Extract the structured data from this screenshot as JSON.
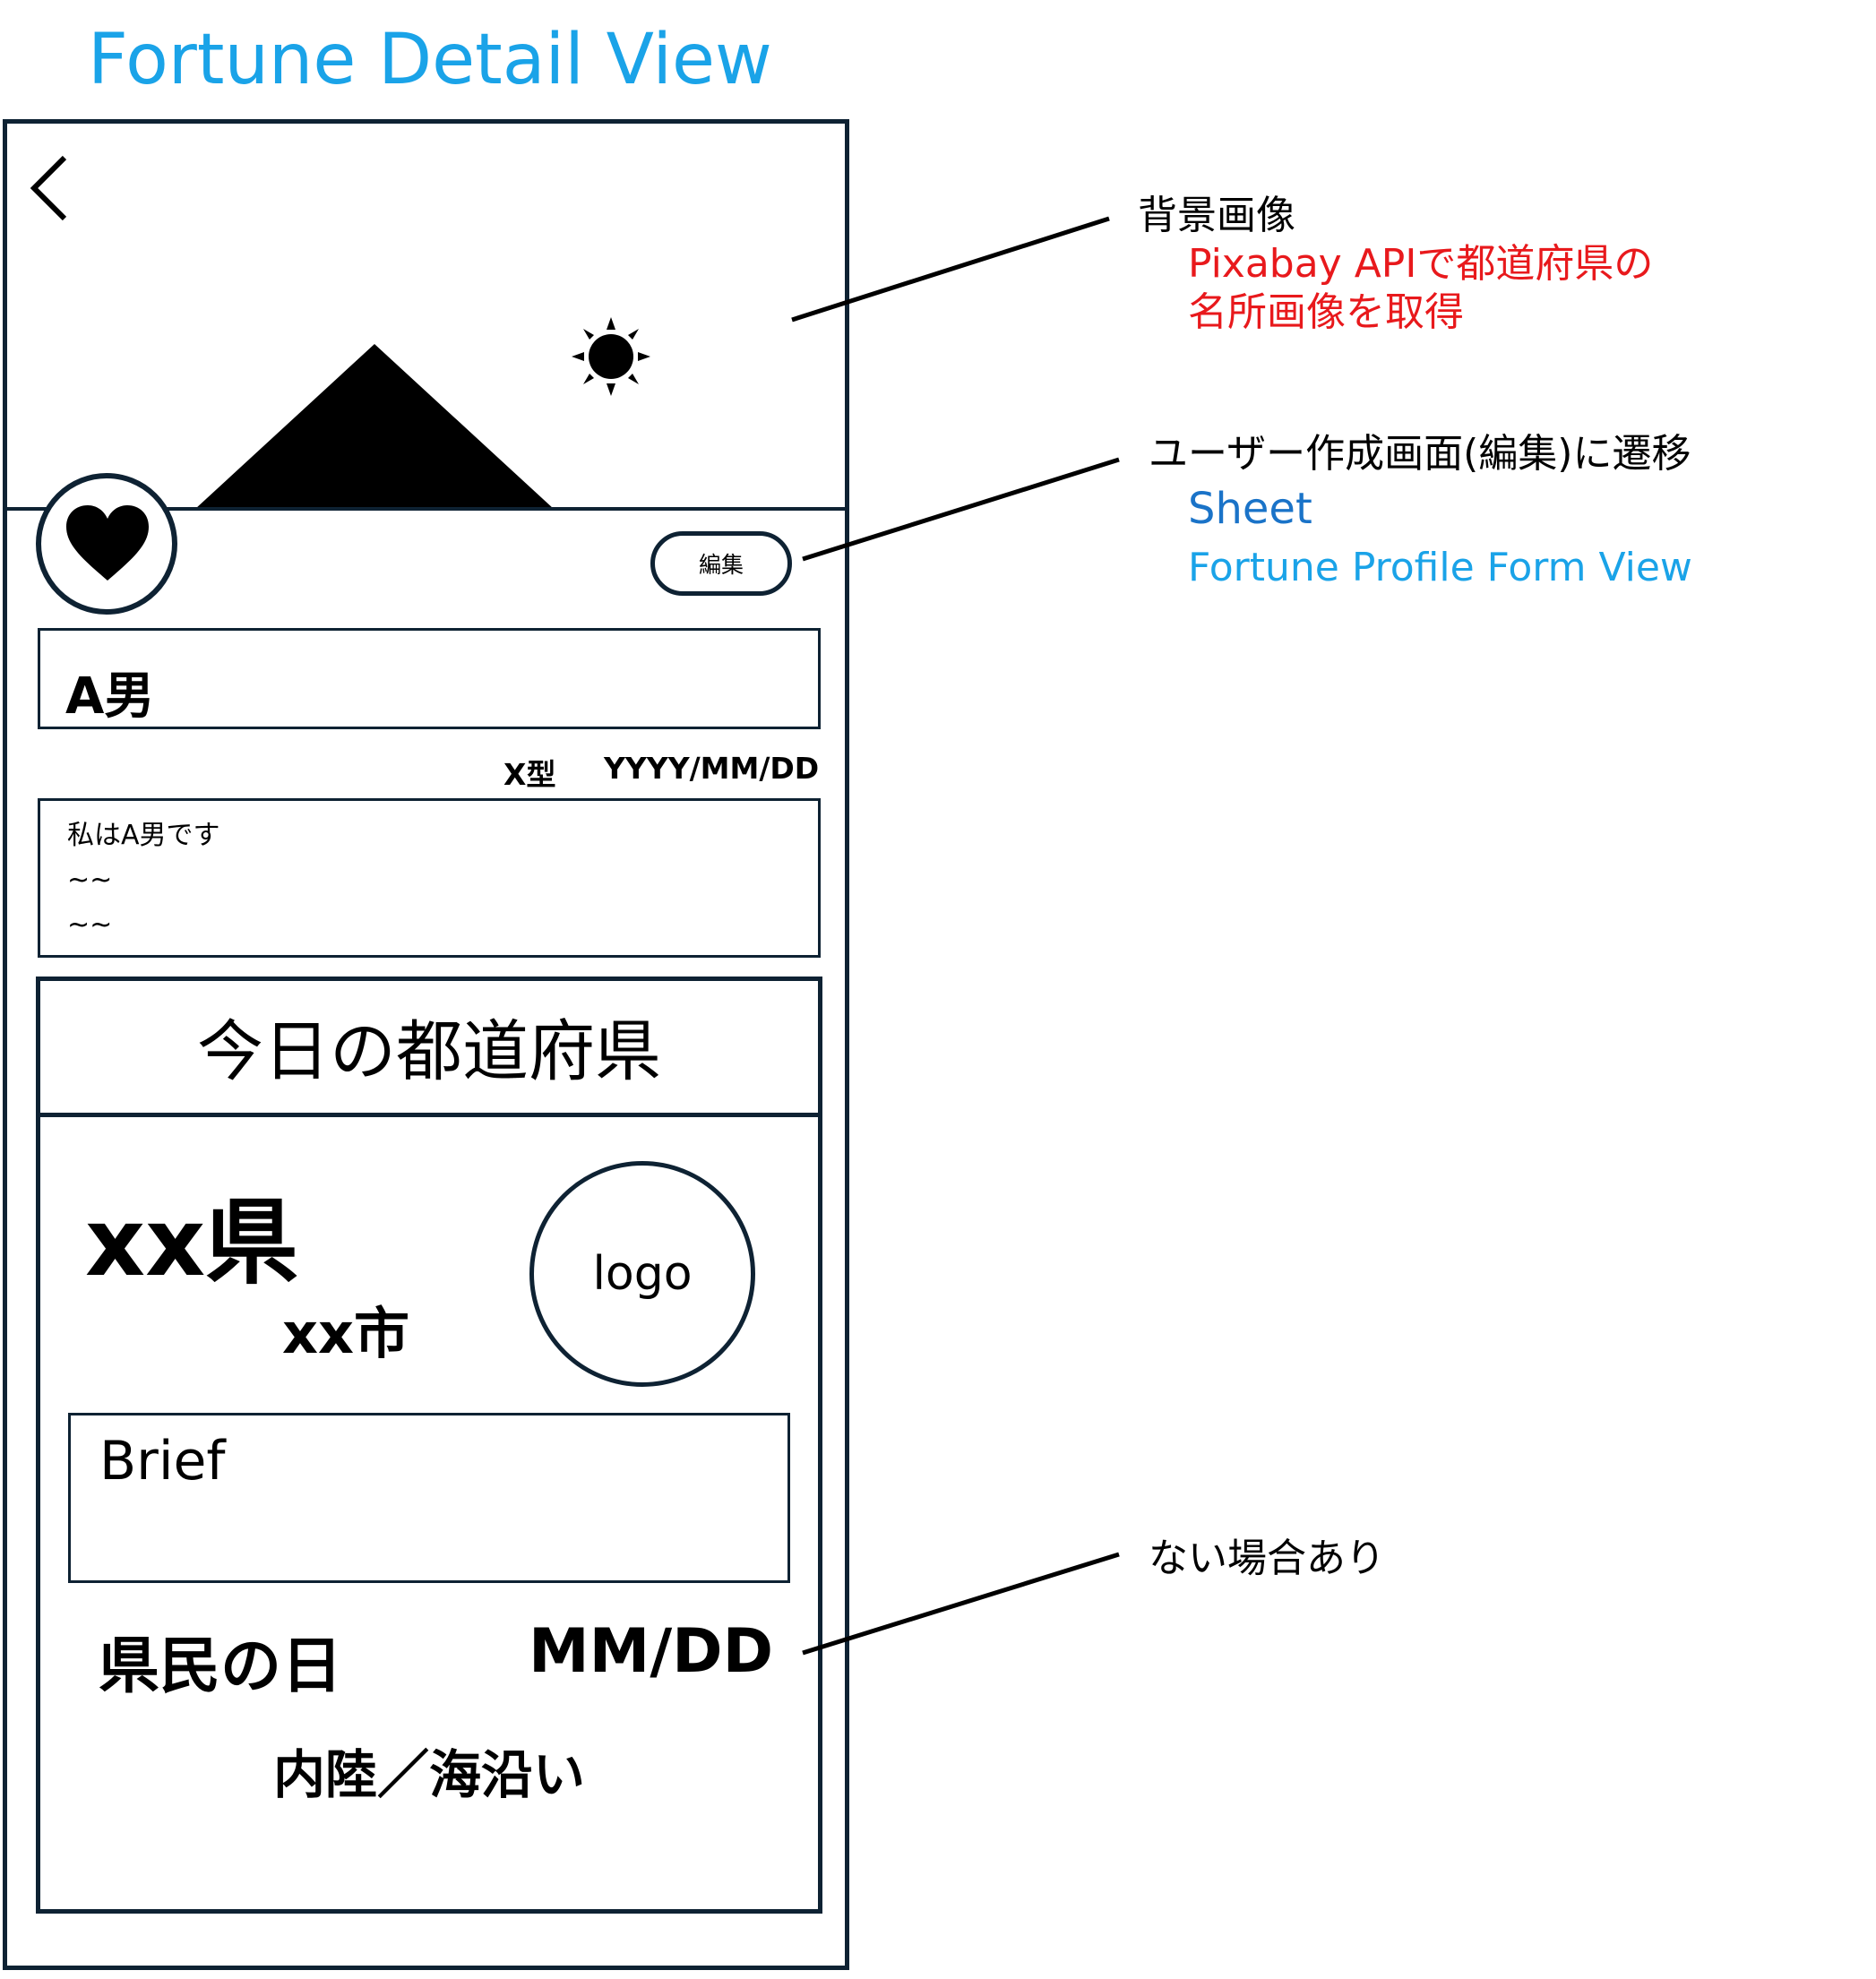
{
  "page_title": "Fortune Detail View",
  "header": {
    "back_icon": "chevron-left-icon"
  },
  "hero": {
    "mountain_icon": "mountain-icon",
    "sun_icon": "sun-icon"
  },
  "favorite": {
    "icon": "heart-icon"
  },
  "edit_button": {
    "label": "編集"
  },
  "profile": {
    "name": "A男",
    "blood_type": "X型",
    "birthday": "YYYY/MM/DD",
    "bio_lines": [
      "私はA男です",
      "~~",
      "~~"
    ]
  },
  "prefecture_card": {
    "title": "今日の都道府県",
    "prefecture": "xx県",
    "capital": "xx市",
    "logo_label": "logo",
    "brief_label": "Brief",
    "citizens_day_label": "県民の日",
    "citizens_day_date": "MM/DD",
    "coast_label": "内陸／海沿い"
  },
  "annotations": {
    "background": {
      "title": "背景画像",
      "line1": "Pixabay APIで都道府県の",
      "line2": "名所画像を取得"
    },
    "edit": {
      "title": "ユーザー作成画面(編集)に遷移",
      "sheet": "Sheet",
      "view": "Fortune Profile Form View"
    },
    "optional": {
      "title": "ない場合あり"
    }
  },
  "colors": {
    "title_blue": "#1aa3e8",
    "api_red": "#e8191c",
    "sheet_blue": "#1a73c8",
    "frame_dark": "#0e2233"
  }
}
